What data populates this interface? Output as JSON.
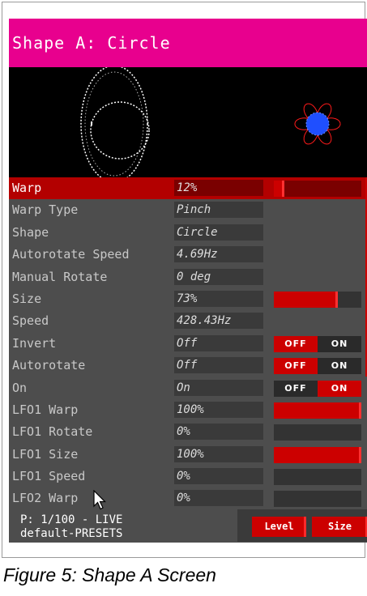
{
  "title": "Shape A: Circle",
  "params": [
    {
      "name": "Warp",
      "value": "12%",
      "control": "bar",
      "level": 0.12,
      "selected": true
    },
    {
      "name": "Warp Type",
      "value": "Pinch",
      "control": "none"
    },
    {
      "name": "Shape",
      "value": "Circle",
      "control": "none"
    },
    {
      "name": "Autorotate Speed",
      "value": "4.69Hz",
      "control": "none"
    },
    {
      "name": "Manual Rotate",
      "value": "0 deg",
      "control": "none"
    },
    {
      "name": "Size",
      "value": "73%",
      "control": "bar",
      "level": 0.73
    },
    {
      "name": "Speed",
      "value": "428.43Hz",
      "control": "none"
    },
    {
      "name": "Invert",
      "value": "Off",
      "control": "toggle",
      "state": "OFF"
    },
    {
      "name": "Autorotate",
      "value": "Off",
      "control": "toggle",
      "state": "OFF"
    },
    {
      "name": "On",
      "value": "On",
      "control": "toggle",
      "state": "ON"
    },
    {
      "name": "LFO1 Warp",
      "value": "100%",
      "control": "bar",
      "level": 1.0
    },
    {
      "name": "LFO1 Rotate",
      "value": "0%",
      "control": "bar",
      "level": 0.0
    },
    {
      "name": "LFO1 Size",
      "value": "100%",
      "control": "bar",
      "level": 1.0
    },
    {
      "name": "LFO1 Speed",
      "value": "0%",
      "control": "bar",
      "level": 0.0
    },
    {
      "name": "LFO2 Warp",
      "value": "0%",
      "control": "bar",
      "level": 0.0
    }
  ],
  "toggle_labels": {
    "off": "OFF",
    "on": "ON"
  },
  "footer": {
    "preset": "P: 1/100 - LIVE",
    "bank": "default-PRESETS",
    "level_button": "Level",
    "size_button": "Size"
  },
  "caption": "Figure 5: Shape A Screen",
  "colors": {
    "title_bar": "#e8008e",
    "accent_red": "#cc0000",
    "panel_grey": "#4d4d4d",
    "preview_bg": "#000000"
  },
  "icons": [
    "mouse-pointer-icon"
  ]
}
